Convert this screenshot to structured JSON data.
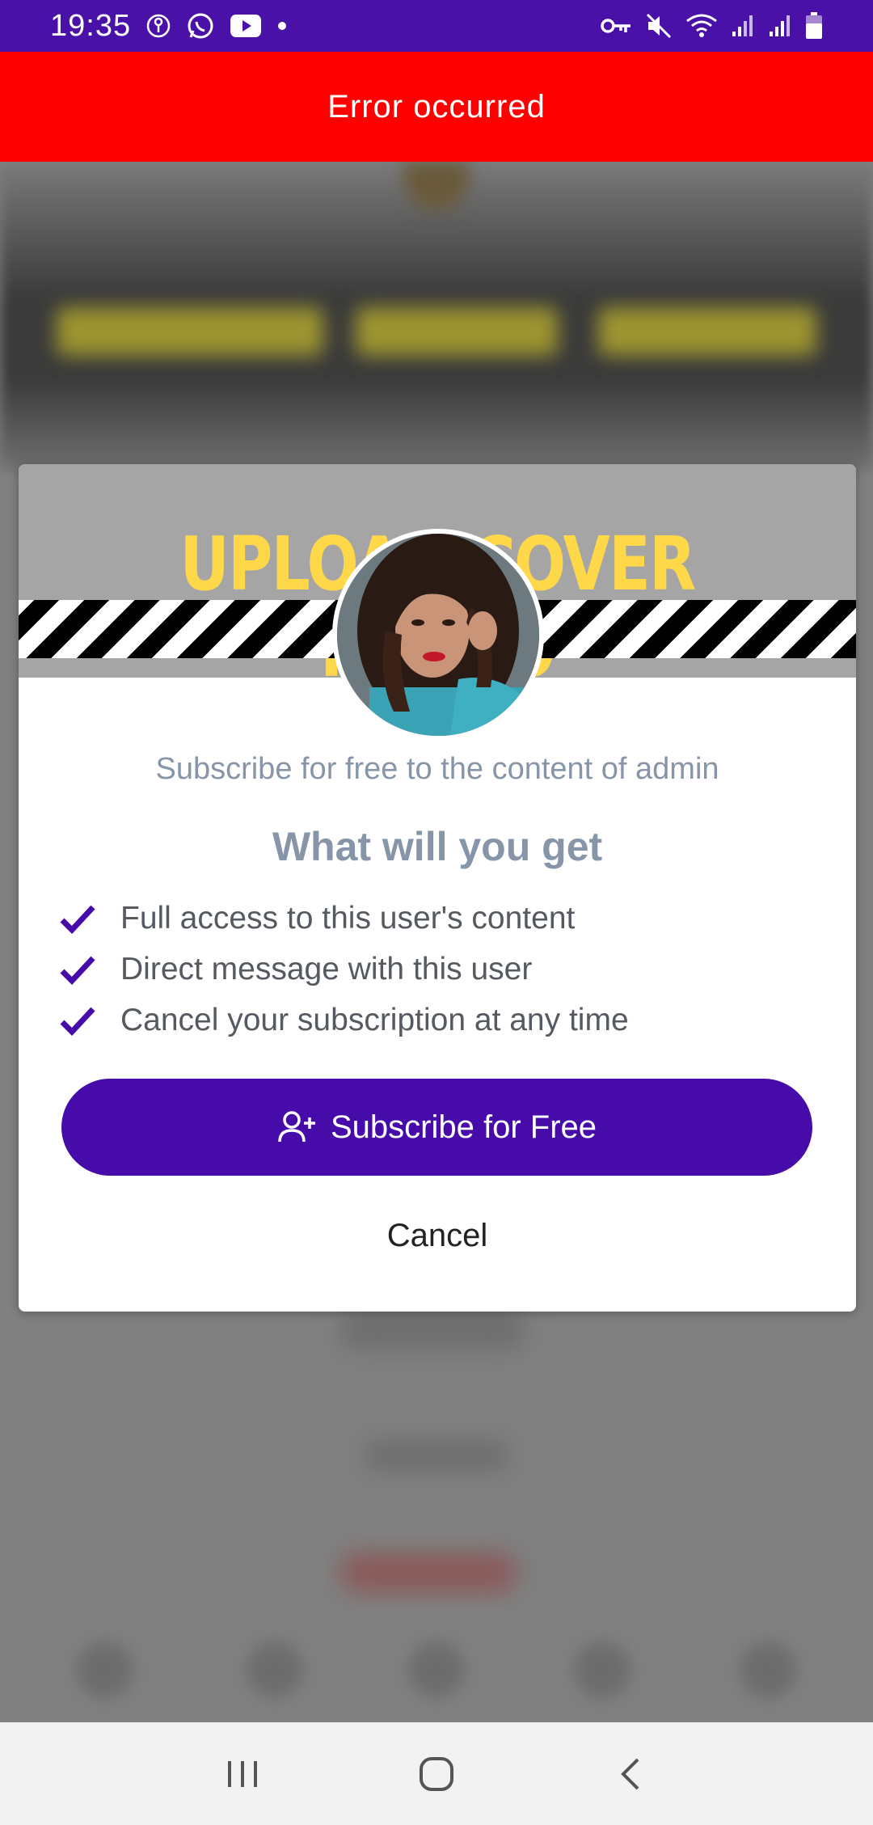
{
  "status_bar": {
    "time": "19:35",
    "left_icons": [
      "key-circle-icon",
      "whatsapp-icon",
      "youtube-icon",
      "dot-icon"
    ],
    "right_icons": [
      "vpn-key-icon",
      "mute-icon",
      "wifi-icon",
      "signal-icon",
      "signal-icon",
      "battery-icon"
    ]
  },
  "banner": {
    "text": "Error occurred",
    "color": "#ff0000"
  },
  "modal": {
    "cover_title": "UPLOAD COVER PHOTO",
    "subtitle": "Subscribe for free to the content of admin",
    "heading": "What will you get",
    "features": [
      "Full access to this user's content",
      "Direct message with this user",
      "Cancel your subscription at any time"
    ],
    "subscribe_label": "Subscribe for Free",
    "cancel_label": "Cancel"
  },
  "nav_bar": {
    "buttons": [
      "recents-icon",
      "home-icon",
      "back-icon"
    ]
  },
  "colors": {
    "accent": "#460ba8",
    "status_bar": "#4a11a8",
    "muted_text": "#8795a9",
    "cover_title": "#ffd84a"
  }
}
